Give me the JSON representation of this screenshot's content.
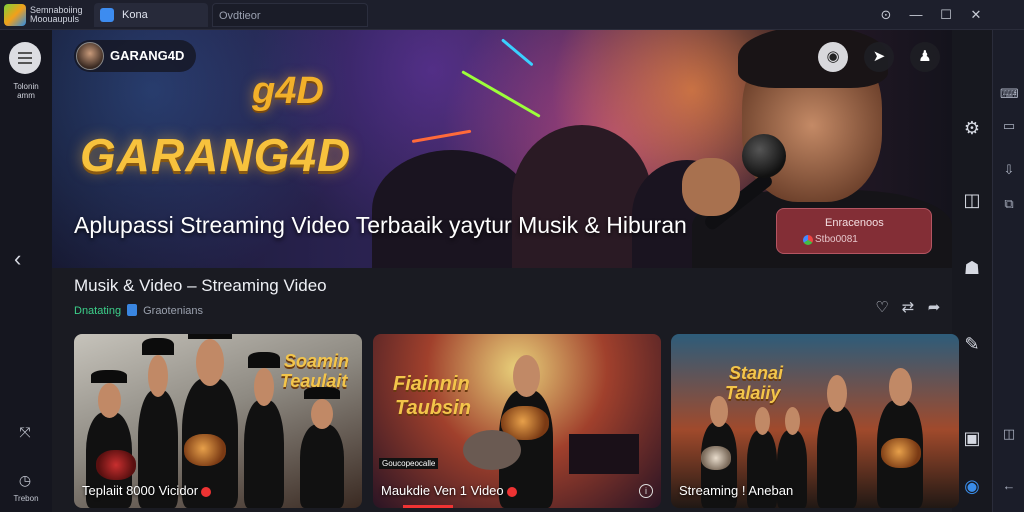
{
  "window": {
    "app_name": "Semnaboiing Moouaupuls",
    "tab_active": "Kona",
    "tab_inactive": "Ovdtieor",
    "btn_help": "⊙",
    "btn_min": "—",
    "btn_max": "☐",
    "btn_close": "✕"
  },
  "leftbar": {
    "label": "Tolonin amm",
    "bottom_label": "Trebon"
  },
  "hero": {
    "brand_name": "GARANG4D",
    "logo_top": "g4D",
    "logo_main": "GARANG4D",
    "title": "Aplupassi Streaming Video Terbaaik yaytur Musik & Hiburan",
    "cta_line1": "Enracenoos",
    "cta_line2": "Stbo0081"
  },
  "section": {
    "title": "Musik & Video – Streaming Video",
    "sub_green": "Dnatating",
    "sub_rest": "Graotenians"
  },
  "cards": [
    {
      "caption": "Teplaiit 8000 Vicidor",
      "brand_line1": "Soamin",
      "brand_line2": "Teaulait"
    },
    {
      "caption": "Maukdie Ven 1 Video",
      "brand_line1": "Fiainnin",
      "brand_line2": "Taubsin",
      "badge": "Goucopeocalle"
    },
    {
      "caption": "Streaming ! Aneban",
      "brand_line1": "Stanai",
      "brand_line2": "Talaiiy"
    }
  ],
  "icons": {
    "menu": "menu-icon",
    "back": "chevron-left-icon",
    "settings": "gear-icon"
  },
  "colors": {
    "accent_gold": "#f7c23d",
    "cta_bg": "#96323c",
    "bg_dark": "#15161f"
  }
}
